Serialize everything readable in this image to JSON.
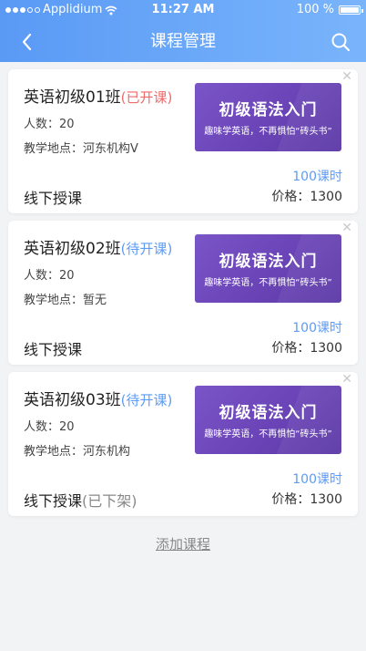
{
  "status_bar": {
    "carrier": "Applidium",
    "time": "11:27 AM",
    "battery": "100 %"
  },
  "navbar": {
    "title": "课程管理",
    "back_icon": "chevron-left-icon",
    "search_icon": "search-icon"
  },
  "courses": [
    {
      "name": "英语初级01班",
      "status": "(已开课)",
      "status_type": "open",
      "count": "人数：20",
      "location": "教学地点：河东机构Ⅴ",
      "banner_title": "初级语法入门",
      "banner_subtitle": "趣味学英语，不再惧怕“砖头书”",
      "hours": "100课时",
      "mode": "线下授课",
      "mode_suffix": "",
      "price": "价格：1300"
    },
    {
      "name": "英语初级02班",
      "status": "(待开课)",
      "status_type": "pending",
      "count": "人数：20",
      "location": "教学地点：暂无",
      "banner_title": "初级语法入门",
      "banner_subtitle": "趣味学英语，不再惧怕“砖头书”",
      "hours": "100课时",
      "mode": "线下授课",
      "mode_suffix": "",
      "price": "价格：1300"
    },
    {
      "name": "英语初级03班",
      "status": "(待开课)",
      "status_type": "pending",
      "count": "人数：20",
      "location": "教学地点：河东机构",
      "banner_title": "初级语法入门",
      "banner_subtitle": "趣味学英语，不再惧怕“砖头书”",
      "hours": "100课时",
      "mode": "线下授课",
      "mode_suffix": "(已下架)",
      "price": "价格：1300"
    }
  ],
  "add_course_label": "添加课程",
  "colors": {
    "header_start": "#5a9af5",
    "header_end": "#79b4fb",
    "status_open": "#f06a6a",
    "status_pending": "#5d9bf5",
    "banner": "#6a44b6"
  }
}
